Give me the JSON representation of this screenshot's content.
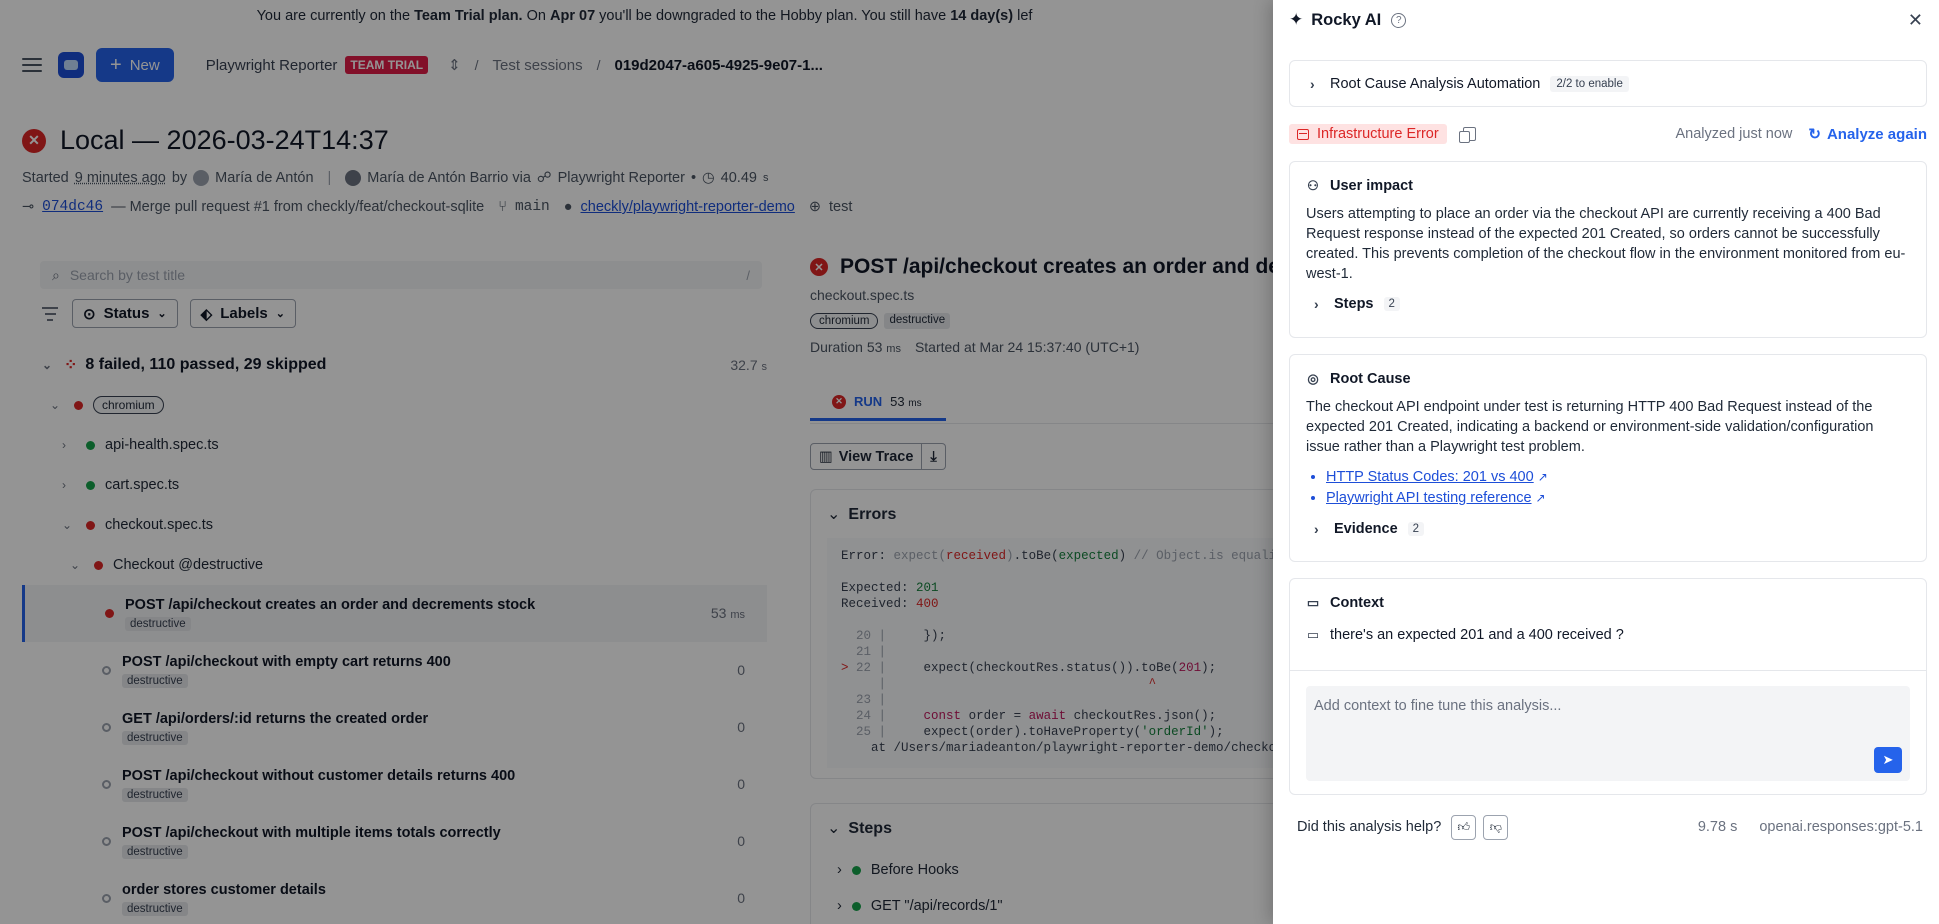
{
  "banner": {
    "prefix": "You are currently on the ",
    "plan": "Team Trial plan.",
    "mid": " On ",
    "date": "Apr 07",
    "mid2": " you'll be downgraded to the Hobby plan. You still have ",
    "days": "14 day(s)",
    "suffix": " lef"
  },
  "topnav": {
    "new_label": "New",
    "project": "Playwright Reporter",
    "trial_badge": "TEAM TRIAL",
    "crumb_sessions": "Test sessions",
    "crumb_id": "019d2047-a605-4925-9e07-1..."
  },
  "session": {
    "title": "Local — 2026-03-24T14:37",
    "started_prefix": "Started",
    "started_ago": "9 minutes ago",
    "by": "by",
    "user_short": "María de Antón",
    "user_full": "María de Antón Barrio via",
    "reporter": "Playwright Reporter",
    "duration": "40.49",
    "duration_unit": "s",
    "commit": "074dc46",
    "commit_msg": "— Merge pull request #1 from checkly/feat/checkout-sqlite",
    "branch": "main",
    "repo": "checkly/playwright-reporter-demo",
    "env": "test"
  },
  "sidebar": {
    "search_placeholder": "Search by test title",
    "search_kbd": "/",
    "status_label": "Status",
    "labels_label": "Labels",
    "summary": "8 failed, 110 passed, 29 skipped",
    "summary_duration": "32.7",
    "summary_unit": "s",
    "project_tag": "chromium",
    "files": [
      "api-health.spec.ts",
      "cart.spec.ts",
      "checkout.spec.ts"
    ],
    "group": "Checkout @destructive",
    "tests": [
      {
        "title": "POST /api/checkout creates an order and decrements stock",
        "tag": "destructive",
        "value": "53",
        "unit": "ms"
      },
      {
        "title": "POST /api/checkout with empty cart returns 400",
        "tag": "destructive",
        "value": "0",
        "unit": ""
      },
      {
        "title": "GET /api/orders/:id returns the created order",
        "tag": "destructive",
        "value": "0",
        "unit": ""
      },
      {
        "title": "POST /api/checkout without customer details returns 400",
        "tag": "destructive",
        "value": "0",
        "unit": ""
      },
      {
        "title": "POST /api/checkout with multiple items totals correctly",
        "tag": "destructive",
        "value": "0",
        "unit": ""
      },
      {
        "title": "order stores customer details",
        "tag": "destructive",
        "value": "0",
        "unit": ""
      }
    ]
  },
  "detail": {
    "title": "POST /api/checkout creates an order and de",
    "file": "checkout.spec.ts",
    "tag1": "chromium",
    "tag2": "destructive",
    "duration_label": "Duration",
    "duration": "53",
    "duration_unit": "ms",
    "started": "Started at Mar 24 15:37:40 (UTC+1)",
    "run_label": "RUN",
    "run_duration": "53",
    "run_unit": "ms",
    "view_trace": "View Trace",
    "errors_title": "Errors",
    "steps_title": "Steps",
    "steps": [
      "Before Hooks",
      "GET \"/api/records/1\""
    ]
  },
  "rocky": {
    "title": "Rocky AI",
    "rca_label": "Root Cause Analysis Automation",
    "rca_badge": "2/2 to enable",
    "error_type": "Infrastructure Error",
    "analyzed": "Analyzed just now",
    "analyze_again": "Analyze again",
    "impact_title": "User impact",
    "impact_text": "Users attempting to place an order via the checkout API are currently receiving a 400 Bad Request response instead of the expected 201 Created, so orders cannot be successfully created. This prevents completion of the checkout flow in the environment monitored from eu-west-1.",
    "steps_label": "Steps",
    "steps_count": "2",
    "root_title": "Root Cause",
    "root_text": "The checkout API endpoint under test is returning HTTP 400 Bad Request instead of the expected 201 Created, indicating a backend or environment-side validation/configuration issue rather than a Playwright test problem.",
    "links": [
      "HTTP Status Codes: 201 vs 400",
      "Playwright API testing reference"
    ],
    "evidence_label": "Evidence",
    "evidence_count": "2",
    "context_title": "Context",
    "context_msg": "there's an expected 201 and a 400 received ?",
    "context_placeholder": "Add context to fine tune this analysis...",
    "feedback_q": "Did this analysis help?",
    "elapsed": "9.78 s",
    "model": "openai.responses:gpt-5.1"
  },
  "colors": {
    "accent": "#2563eb",
    "fail": "#dc2626",
    "pass": "#16a34a",
    "trial": "#e11d48"
  }
}
